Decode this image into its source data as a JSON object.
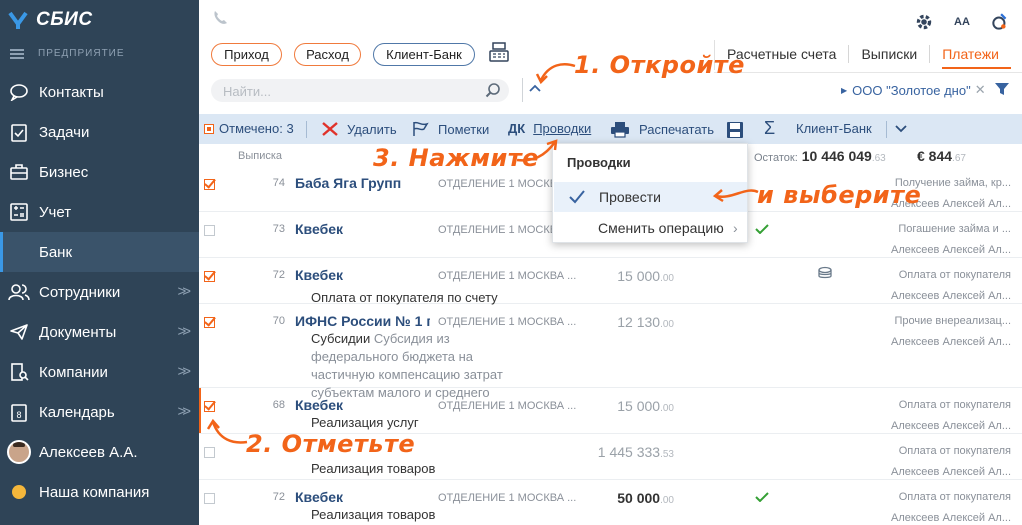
{
  "app": {
    "name": "СБИС"
  },
  "sidebar": {
    "section": "ПРЕДПРИЯТИЕ",
    "items": [
      {
        "label": "Контакты"
      },
      {
        "label": "Задачи"
      },
      {
        "label": "Бизнес"
      },
      {
        "label": "Учет"
      },
      {
        "label": "Банк"
      },
      {
        "label": "Сотрудники"
      },
      {
        "label": "Документы"
      },
      {
        "label": "Компании"
      },
      {
        "label": "Календарь"
      },
      {
        "label": "Алексеев А.А."
      },
      {
        "label": "Наша компания"
      }
    ],
    "calendar_day": "8"
  },
  "top_icons": {
    "font_label": "AA"
  },
  "toolbar": {
    "prihod": "Приход",
    "rashod": "Расход",
    "client_bank": "Клиент-Банк"
  },
  "tabs": [
    {
      "label": "Расчетные счета"
    },
    {
      "label": "Выписки"
    },
    {
      "label": "Платежи"
    }
  ],
  "search": {
    "placeholder": "Найти..."
  },
  "organization": "ООО \"Золотое дно\"",
  "actions": {
    "marked": "Отмечено: 3",
    "delete": "Удалить",
    "marks": "Пометки",
    "dk": "ДК",
    "postings": "Проводки",
    "print": "Распечатать",
    "client_bank": "Клиент-Банк"
  },
  "list": {
    "column_statement": "Выписка",
    "balance_label": "Остаток:",
    "balance_main": "10 446 049",
    "balance_kop": ".63",
    "euro_main": "€ 844",
    "euro_kop": ".67"
  },
  "rows": [
    {
      "num": "74",
      "name": "Баба Яга Групп",
      "dept": "ОТДЕЛЕНИЕ 1 МОСКВА ...",
      "sum": "",
      "kop": "",
      "desc": "",
      "desc2": "",
      "right_top": "Получение займа, кр...",
      "right_bottom": "Алексеев Алексей Ал...",
      "checked": true
    },
    {
      "num": "73",
      "name": "Квебек",
      "dept": "ОТДЕЛЕНИЕ 1 МОСКВА ...",
      "sum": "",
      "kop": "",
      "desc": "",
      "desc2": "",
      "right_top": "Погашение займа и ...",
      "right_bottom": "Алексеев Алексей Ал...",
      "checked": false
    },
    {
      "num": "72",
      "name": "Квебек",
      "dept": "ОТДЕЛЕНИЕ 1 МОСКВА ...",
      "sum": "15 000",
      "kop": ".00",
      "desc": "Оплата от покупателя по счету",
      "desc2": "",
      "right_top": "Оплата от покупателя",
      "right_bottom": "Алексеев Алексей Ал...",
      "checked": true
    },
    {
      "num": "70",
      "name": "ИФНС России № 1 п",
      "dept": "ОТДЕЛЕНИЕ 1 МОСКВА ...",
      "sum": "12 130",
      "kop": ".00",
      "desc": "Субсидии",
      "desc2": "Субсидия из федерального бюджета на частичную компенсацию затрат субъектам малого и среднего",
      "right_top": "Прочие внереализац...",
      "right_bottom": "Алексеев Алексей Ал...",
      "checked": true
    },
    {
      "num": "68",
      "name": "Квебек",
      "dept": "ОТДЕЛЕНИЕ 1 МОСКВА ...",
      "sum": "15 000",
      "kop": ".00",
      "desc": "Реализация услуг",
      "desc2": "",
      "right_top": "Оплата от покупателя",
      "right_bottom": "Алексеев Алексей Ал...",
      "checked": true
    },
    {
      "num": "",
      "name": "",
      "dept": "",
      "sum": "1 445 333",
      "kop": ".53",
      "desc": "Реализация товаров",
      "desc2": "",
      "right_top": "Оплата от покупателя",
      "right_bottom": "Алексеев Алексей Ал...",
      "checked": false
    },
    {
      "num": "72",
      "name": "Квебек",
      "dept": "ОТДЕЛЕНИЕ 1 МОСКВА ...",
      "sum": "50 000",
      "kop": ".00",
      "desc": "Реализация товаров",
      "desc2": "",
      "right_top": "Оплата от покупателя",
      "right_bottom": "Алексеев Алексей Ал...",
      "checked": false
    }
  ],
  "dropdown": {
    "title": "Проводки",
    "item1": "Провести",
    "item2": "Сменить операцию"
  },
  "annotations": {
    "step1": "1. Откройте",
    "step2": "2. Отметьте",
    "step3": "3. Нажмите",
    "step4": "и выберите"
  },
  "colors": {
    "accent": "#f26419",
    "sidebar": "#2f4457",
    "link": "#2c4e7c",
    "actionbar": "#dbe7f4"
  }
}
